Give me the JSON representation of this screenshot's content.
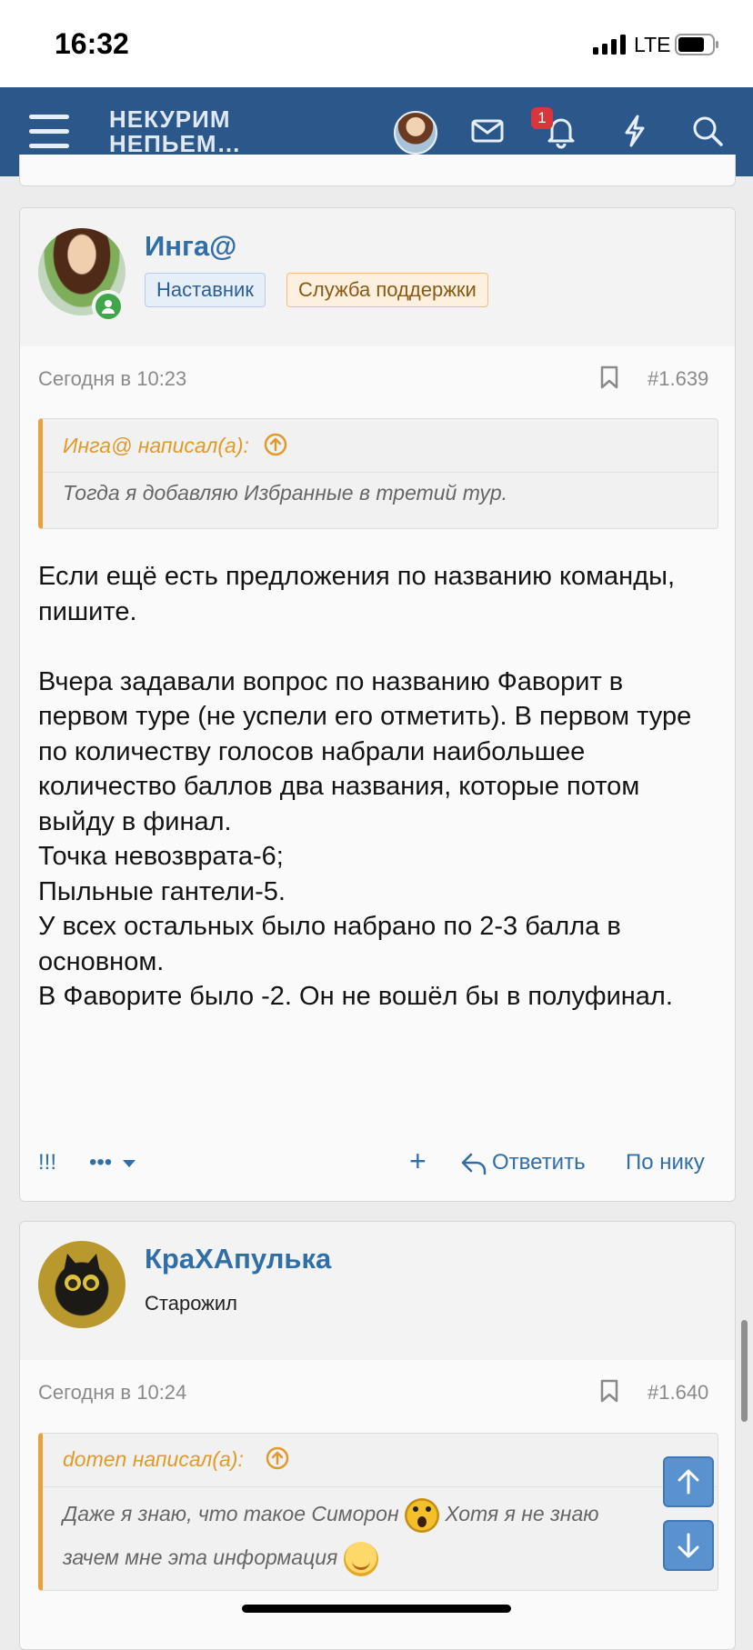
{
  "status_bar": {
    "time": "16:32",
    "network": "LTE"
  },
  "nav": {
    "logo_line1": "НЕКУРИМ",
    "logo_line2": "НЕПЬЕМ…",
    "notification_count": "1"
  },
  "posts": [
    {
      "author": "Инга@",
      "badges": [
        "Наставник",
        "Служба поддержки"
      ],
      "date": "Сегодня в 10:23",
      "number": "#1.639",
      "quote_author": "Инга@ написал(а):",
      "quote_text": "Тогда я добавляю Избранные в третий тур.",
      "body": [
        "Если ещё есть предложения по названию команды, пишите.",
        "",
        "Вчера задавали вопрос по названию Фаворит в первом туре (не успели его отметить). В первом туре по количеству голосов набрали наибольшее количество баллов два названия, которые потом выйду в финал.",
        "Точка невозврата-6;",
        "Пыльные гантели-5.",
        "У всех остальных было набрано по 2-3 балла в основном.",
        "В Фаворите было -2. Он не вошёл бы в полуфинал."
      ],
      "actions": {
        "left1": "!!!",
        "left2": "•••",
        "plus": "+",
        "reply": "Ответить",
        "by_nick": "По нику"
      }
    },
    {
      "author": "КраХАпулька",
      "user_title": "Старожил",
      "date": "Сегодня в 10:24",
      "number": "#1.640",
      "quote_author": "domen написал(а):",
      "quote_text_part1": "Даже я знаю, что такое Симорон",
      "quote_text_part2": "Хотя я не знаю",
      "quote_text_part3": "зачем мне эта информация"
    }
  ]
}
